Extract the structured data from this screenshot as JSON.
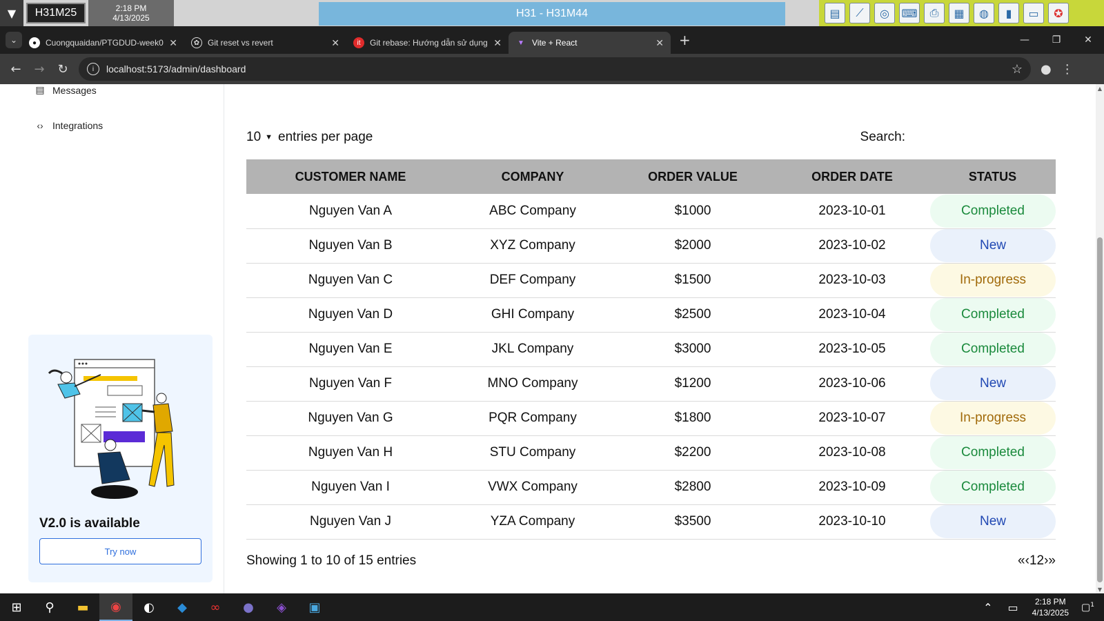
{
  "remote_bar": {
    "machine": "H31M25",
    "time": "2:18 PM",
    "date": "4/13/2025",
    "title": "H31 - H31M44",
    "tools": [
      "filing-cabinet-icon",
      "chart-icon",
      "disc-icon",
      "keyboard-icon",
      "printer-icon",
      "window-icon",
      "globe-icon",
      "book-icon",
      "chat-icon",
      "lifebuoy-icon"
    ]
  },
  "browser": {
    "tabs": [
      {
        "title": "Cuongquaidan/PTGDUD-week0",
        "icon": "github-icon",
        "active": false
      },
      {
        "title": "Git reset vs revert",
        "icon": "openai-icon",
        "active": false
      },
      {
        "title": "Git rebase: Hướng dẫn sử dụng",
        "icon": "itviec-icon",
        "active": false
      },
      {
        "title": "Vite + React",
        "icon": "vite-icon",
        "active": true
      }
    ],
    "url": "localhost:5173/admin/dashboard"
  },
  "sidebar": {
    "items": [
      {
        "label": "Messages",
        "icon": "message-icon"
      },
      {
        "label": "Integrations",
        "icon": "code-icon"
      }
    ],
    "promo": {
      "title": "V2.0 is available",
      "button": "Try now"
    }
  },
  "table_controls": {
    "entries_value": "10",
    "entries_label": "entries per page",
    "search_label": "Search:"
  },
  "orders_table": {
    "columns": [
      "CUSTOMER NAME",
      "COMPANY",
      "ORDER VALUE",
      "ORDER DATE",
      "STATUS"
    ],
    "rows": [
      {
        "customer": "Nguyen Van A",
        "company": "ABC Company",
        "value": "$1000",
        "date": "2023-10-01",
        "status": "Completed"
      },
      {
        "customer": "Nguyen Van B",
        "company": "XYZ Company",
        "value": "$2000",
        "date": "2023-10-02",
        "status": "New"
      },
      {
        "customer": "Nguyen Van C",
        "company": "DEF Company",
        "value": "$1500",
        "date": "2023-10-03",
        "status": "In-progress"
      },
      {
        "customer": "Nguyen Van D",
        "company": "GHI Company",
        "value": "$2500",
        "date": "2023-10-04",
        "status": "Completed"
      },
      {
        "customer": "Nguyen Van E",
        "company": "JKL Company",
        "value": "$3000",
        "date": "2023-10-05",
        "status": "Completed"
      },
      {
        "customer": "Nguyen Van F",
        "company": "MNO Company",
        "value": "$1200",
        "date": "2023-10-06",
        "status": "New"
      },
      {
        "customer": "Nguyen Van G",
        "company": "PQR Company",
        "value": "$1800",
        "date": "2023-10-07",
        "status": "In-progress"
      },
      {
        "customer": "Nguyen Van H",
        "company": "STU Company",
        "value": "$2200",
        "date": "2023-10-08",
        "status": "Completed"
      },
      {
        "customer": "Nguyen Van I",
        "company": "VWX Company",
        "value": "$2800",
        "date": "2023-10-09",
        "status": "Completed"
      },
      {
        "customer": "Nguyen Van J",
        "company": "YZA Company",
        "value": "$3500",
        "date": "2023-10-10",
        "status": "New"
      }
    ]
  },
  "table_footer": {
    "info": "Showing 1 to 10 of 15 entries",
    "pager": {
      "first": "«",
      "prev": "‹",
      "pages": [
        "1",
        "2"
      ],
      "next": "›",
      "last": "»"
    }
  },
  "taskbar": {
    "apps": [
      "windows-start-icon",
      "search-icon",
      "file-explorer-icon",
      "chrome-icon",
      "app-icon",
      "vscode-icon",
      "oo-icon",
      "eclipse-icon",
      "visual-studio-icon",
      "remote-icon"
    ],
    "time": "2:18 PM",
    "date": "4/13/2025",
    "notification_count": "1"
  }
}
